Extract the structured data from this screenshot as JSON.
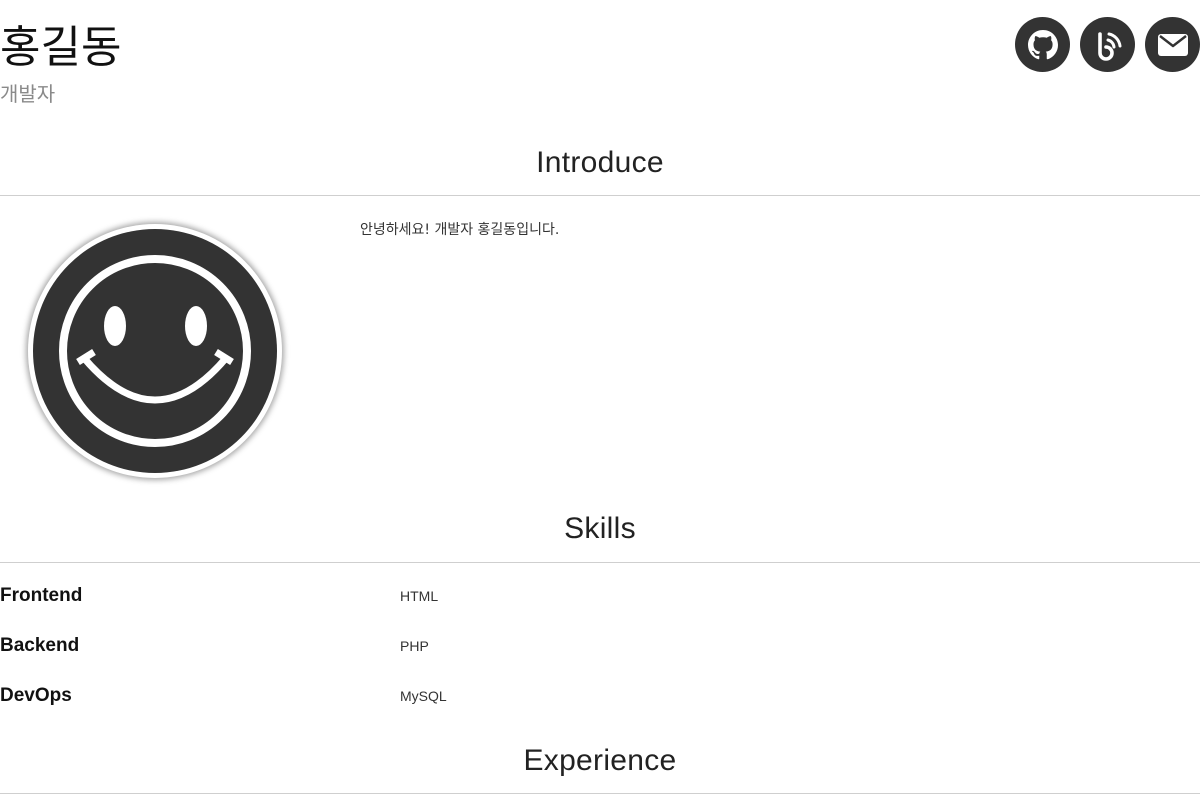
{
  "header": {
    "name": "홍길동",
    "role": "개발자",
    "social": [
      {
        "icon": "github-icon",
        "label": "GitHub"
      },
      {
        "icon": "blog-icon",
        "label": "Blog"
      },
      {
        "icon": "email-icon",
        "label": "Email"
      }
    ]
  },
  "introduce": {
    "title": "Introduce",
    "avatar_icon": "smiley-icon",
    "text": "안녕하세요! 개발자 홍길동입니다."
  },
  "skills": {
    "title": "Skills",
    "items": [
      {
        "category": "Frontend",
        "value": "HTML"
      },
      {
        "category": "Backend",
        "value": "PHP"
      },
      {
        "category": "DevOps",
        "value": "MySQL"
      }
    ]
  },
  "experience": {
    "title": "Experience"
  },
  "colors": {
    "icon_bg": "#333333",
    "divider": "#cfcfcf",
    "subtitle": "#8a8a8a"
  }
}
